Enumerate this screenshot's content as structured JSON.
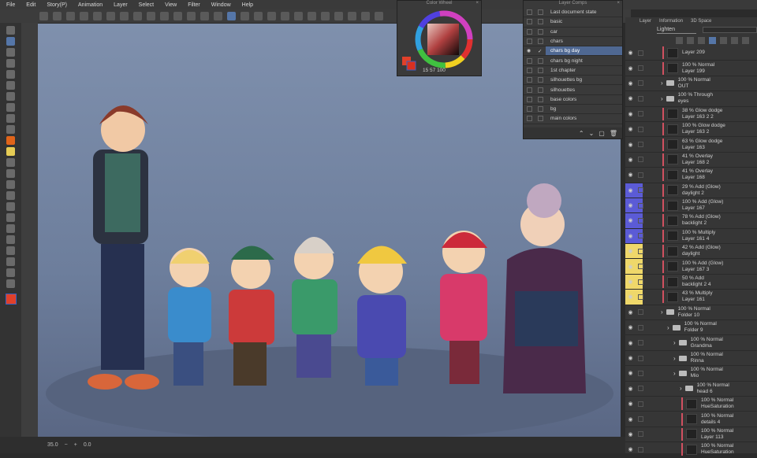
{
  "menu": [
    "File",
    "Edit",
    "Story(P)",
    "Animation",
    "Layer",
    "Select",
    "View",
    "Filter",
    "Window",
    "Help"
  ],
  "layer_comps": {
    "title": "Layer Comps",
    "items": [
      {
        "label": "Last document state",
        "checked": false
      },
      {
        "label": "basic"
      },
      {
        "label": "car"
      },
      {
        "label": "chars"
      },
      {
        "label": "chars bg day",
        "selected": true,
        "check": "✓",
        "eye": "👁"
      },
      {
        "label": "chars bg night"
      },
      {
        "label": "1st chapter"
      },
      {
        "label": "silhouettes bg"
      },
      {
        "label": "silhouettes"
      },
      {
        "label": "base colors"
      },
      {
        "label": "bg"
      },
      {
        "label": "main colors"
      }
    ]
  },
  "color_wheel": {
    "title": "Color Wheel",
    "values": "15  57  100",
    "main_color": "#e0402a",
    "sub_color": "#3a5fc0"
  },
  "layers_panel": {
    "tabs": [
      "Layer",
      "Information",
      "3D Space"
    ],
    "blend": "Lighten",
    "rows": [
      {
        "op": "",
        "name": "Layer 209",
        "type": "layer"
      },
      {
        "op": "100 % Normal",
        "name": "Layer 199",
        "type": "layer"
      },
      {
        "op": "100 % Normal",
        "name": "OUT",
        "type": "folder"
      },
      {
        "op": "100 % Through",
        "name": "eyes",
        "type": "folder"
      },
      {
        "op": "38 % Glow dodge",
        "name": "Layer 163 2 2",
        "type": "layer"
      },
      {
        "op": "100 % Glow dodge",
        "name": "Layer 163 2",
        "type": "layer"
      },
      {
        "op": "63 % Glow dodge",
        "name": "Layer 163",
        "type": "layer"
      },
      {
        "op": "41 % Overlay",
        "name": "Layer 168 2",
        "type": "layer"
      },
      {
        "op": "41 % Overlay",
        "name": "Layer 168",
        "type": "layer"
      },
      {
        "op": "29 % Add (Glow)",
        "name": "daylight 2",
        "type": "layer",
        "color": "#5b5bd6"
      },
      {
        "op": "100 % Add (Glow)",
        "name": "Layer 167",
        "type": "layer",
        "color": "#5b5bd6"
      },
      {
        "op": "78 % Add (Glow)",
        "name": "backlight 2",
        "type": "layer",
        "color": "#5b5bd6"
      },
      {
        "op": "100 % Multiply",
        "name": "Layer 161 4",
        "type": "layer",
        "color": "#5b5bd6"
      },
      {
        "op": "42 % Add (Glow)",
        "name": "daylight",
        "type": "layer",
        "color": "#efd86a"
      },
      {
        "op": "100 % Add (Glow)",
        "name": "Layer 167 3",
        "type": "layer",
        "color": "#efd86a"
      },
      {
        "op": "50 % Add",
        "name": "backlight 2 4",
        "type": "layer",
        "color": "#efd86a"
      },
      {
        "op": "43 % Multiply",
        "name": "Layer 161",
        "type": "layer",
        "color": "#efd86a"
      },
      {
        "op": "100 % Normal",
        "name": "Folder 10",
        "type": "folder",
        "indent": 0
      },
      {
        "op": "100 % Normal",
        "name": "Folder 9",
        "type": "folder",
        "indent": 1
      },
      {
        "op": "100 % Normal",
        "name": "Grandma",
        "type": "folder",
        "indent": 2
      },
      {
        "op": "100 % Normal",
        "name": "Rinna",
        "type": "folder",
        "indent": 2
      },
      {
        "op": "100 % Normal",
        "name": "Mio",
        "type": "folder",
        "indent": 2
      },
      {
        "op": "100 % Normal",
        "name": "head 6",
        "type": "folder",
        "indent": 3
      },
      {
        "op": "100 % Normal",
        "name": "HueSaturation",
        "type": "layer",
        "indent": 3
      },
      {
        "op": "100 % Normal",
        "name": "details 4",
        "type": "layer",
        "indent": 3
      },
      {
        "op": "100 % Normal",
        "name": "Layer 113",
        "type": "layer",
        "indent": 3
      },
      {
        "op": "100 % Normal",
        "name": "HueSaturation",
        "type": "layer",
        "indent": 3
      }
    ]
  },
  "status": {
    "zoom": "35.0",
    "angle": "0.0"
  }
}
